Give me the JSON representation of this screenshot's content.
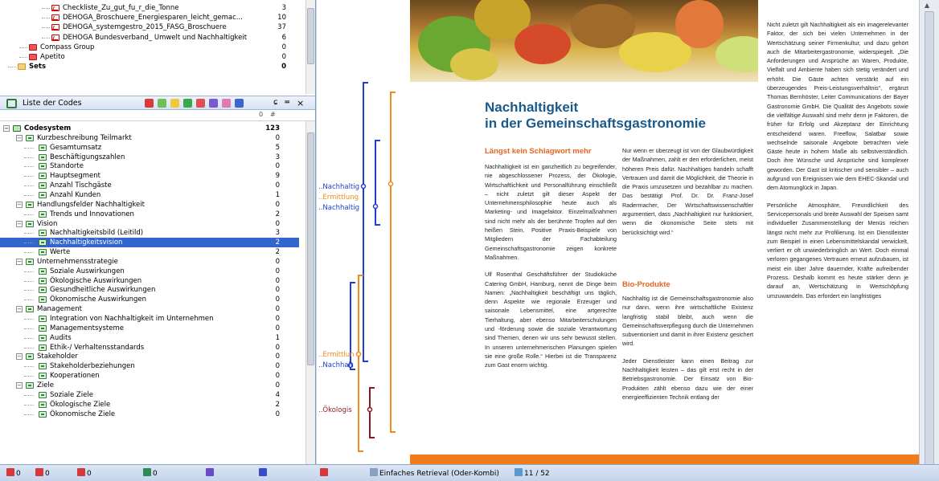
{
  "doc_tree": {
    "rows": [
      {
        "label": "Checkliste_Zu_gut_fu_r_die_Tonne",
        "count": "3",
        "icon": "pdf-icon"
      },
      {
        "label": "DEHOGA_Broschuere_Energiesparen_leicht_gemac...",
        "count": "10",
        "icon": "pdf-icon"
      },
      {
        "label": "DEHOGA_systemgestro_2015_FASG_Broschuere",
        "count": "37",
        "icon": "pdf-icon"
      },
      {
        "label": "DEHOGA Bundesverband_ Umwelt und Nachhaltigkeit",
        "count": "6",
        "icon": "pdf-icon"
      },
      {
        "label": "Compass Group",
        "count": "0",
        "icon": "document-group-icon"
      },
      {
        "label": "Apetito",
        "count": "0",
        "icon": "document-group-icon"
      },
      {
        "label": "Sets",
        "count": "0",
        "icon": "sets-folder-icon"
      }
    ]
  },
  "codes_panel": {
    "title": "Liste der Codes",
    "close": "×",
    "pin": "▫",
    "col_header_count": "#",
    "col_header_zero": "0"
  },
  "code_tree": [
    {
      "label": "Codesystem",
      "count": "123",
      "bold": true
    },
    {
      "label": "Kurzbeschreibung Teilmarkt",
      "count": "0"
    },
    {
      "label": "Gesamtumsatz",
      "count": "5"
    },
    {
      "label": "Beschäftigungszahlen",
      "count": "3"
    },
    {
      "label": "Standorte",
      "count": "0"
    },
    {
      "label": "Hauptsegment",
      "count": "9"
    },
    {
      "label": "Anzahl Tischgäste",
      "count": "0"
    },
    {
      "label": "Anzahl Kunden",
      "count": "1"
    },
    {
      "label": "Handlungsfelder Nachhaltigkeit",
      "count": "0"
    },
    {
      "label": "Trends und Innovationen",
      "count": "2"
    },
    {
      "label": "Vision",
      "count": "0"
    },
    {
      "label": "Nachhaltigkeitsbild (Leitild)",
      "count": "3"
    },
    {
      "label": "Nachhaltigkeitsvision",
      "count": "2",
      "selected": true
    },
    {
      "label": "Werte",
      "count": "2"
    },
    {
      "label": "Unternehmensstrategie",
      "count": "0"
    },
    {
      "label": "Soziale Auswirkungen",
      "count": "0"
    },
    {
      "label": "Ökologische Auswirkungen",
      "count": "0"
    },
    {
      "label": "Gesundheitliche Auswirkungen",
      "count": "0"
    },
    {
      "label": "Ökonomische Auswirkungen",
      "count": "0"
    },
    {
      "label": "Management",
      "count": "0"
    },
    {
      "label": "Integration von Nachhaltigkeit im Unternehmen",
      "count": "0"
    },
    {
      "label": "Managementsysteme",
      "count": "0"
    },
    {
      "label": "Audits",
      "count": "1"
    },
    {
      "label": "Ethik-/ Verhaltensstandards",
      "count": "0"
    },
    {
      "label": "Stakeholder",
      "count": "0"
    },
    {
      "label": "Stakeholderbeziehungen",
      "count": "0"
    },
    {
      "label": "Kooperationen",
      "count": "0"
    },
    {
      "label": "Ziele",
      "count": "0"
    },
    {
      "label": "Soziale Ziele",
      "count": "4"
    },
    {
      "label": "Ökologische Ziele",
      "count": "2"
    },
    {
      "label": "Ökonomische Ziele",
      "count": "0"
    }
  ],
  "coding_stripes": [
    {
      "label": "..Nachhaltig",
      "color": "#1f3fd0"
    },
    {
      "label": "..Ermittlung",
      "color": "#f08a1a"
    },
    {
      "label": "..Nachhaltig",
      "color": "#1f3fd0"
    },
    {
      "label": "..Ermittlun",
      "color": "#f08a1a"
    },
    {
      "label": "..Nachhalt",
      "color": "#1f3fd0"
    },
    {
      "label": "..Ökologis",
      "color": "#8b1a1a"
    }
  ],
  "document": {
    "title_line1": "Nachhaltigkeit",
    "title_line2": "in der Gemeinschaftsgastronomie",
    "sub1": "Längst kein Schlagwort mehr",
    "col1_p1": "Nachhaltigkeit ist ein ganzheitlich zu begreifender, nie abgeschlossener Prozess, der Ökologie, Wirtschaftlichkeit und Personalführung einschließt – nicht zuletzt gilt dieser Aspekt der Unternehmensphilosophie heute auch als Marketing- und Imagefaktor. Einzelmaßnahmen sind nicht mehr als der berühmte Tropfen auf den heißen Stein. Positive Praxis-Beispiele von Mitgliedern der Fachabteilung Gemeinschaftsgastronomie zeigen konkrete Maßnahmen.",
    "col1_p2": "Ulf Rosenthal Geschäftsführer der Studioküche Catering GmbH, Hamburg, nennt die Dinge beim Namen: „Nachhaltigkeit beschäftigt uns täglich, denn Aspekte wie regionale Erzeuger und saisonale Lebensmittel, eine artgerechte Tierhaltung, aber ebenso Mitarbeiterschulungen und -förderung sowie die soziale Verantwortung sind Themen, denen wir uns sehr bewusst stellen. In unseren unternehmerischen Planungen spielen sie eine große Rolle.“ Hierbei ist die Transparenz zum Gast enorm wichtig.",
    "col2_p1": "Nur wenn er überzeugt ist von der Glaubwürdigkeit der Maßnahmen, zahlt er den erforderlichen, meist höheren Preis dafür. Nachhaltiges handeln schafft Vertrauen und damit die Möglichkeit, die Theorie in die Praxis umzusetzen und bezahlbar zu machen. Das bestätigt Prof. Dr. Dr. Franz-Josef Radermacher, Der Wirtschaftswissenschaftler argumentiert, dass „Nachhaltigkeit nur funktioniert, wenn die ökonomische Seite stets mit berücksichtigt wird.“",
    "sub2": "Bio-Produkte",
    "col2_p2": "Nachhaltig ist die Gemeinschaftsgastronomie also nur dann, wenn ihre wirtschaftliche Existenz langfristig stabil bleibt, auch wenn die Gemeinschaftsverpflegung durch die Unternehmen subventioniert und damit in ihrer Existenz gesichert wird.",
    "col2_p3": "Jeder Dienstleister kann einen Beitrag zur Nachhaltigkeit leisten – das gilt erst recht in der Betriebsgastronomie. Der Einsatz von Bio-Produkten zählt ebenso dazu wie der einer energieeffizienten Technik entlang der",
    "col3_p1": "Nicht zuletzt gilt Nachhaltigkeit als ein imagerelevanter Faktor, der sich bei vielen Unternehmen in der Wertschätzung seiner Firmenkultur, und dazu gehört auch die Mitarbeitergastronomie, widerspiegelt. „Die Anforderungen und Ansprüche an Waren, Produkte, Vielfalt und Ambiente haben sich stetig verändert und erhöht. Die Gäste achten verstärkt auf ein überzeugendes Preis-Leistungsverhältnis“, ergänzt Thomas Bernhöster, Leiter Communications der Bayer Gastronomie GmbH. Die Qualität des Angebots sowie die vielfältige Auswahl sind mehr denn je Faktoren, die früher für Erfolg und Akzeptanz der Einrichtung entscheidend waren. Freeflow, Salatbar sowie wechselnde saisonale Angebote betrachten viele Gäste heute in hohem Maße als selbstverständlich. Doch ihre Wünsche und Ansprüche sind komplexer geworden. Der Gast ist kritischer und sensibler – auch aufgrund von Ereignissen wie dem EHEC-Skandal und dem Atomunglück in Japan.",
    "col3_p2": "Persönliche Atmosphäre, Freundlichkeit des Servicepersonals und breite Auswahl der Speisen samt individueller Zusammenstellung der Menüs reichen längst nicht mehr zur Profilierung. Ist ein Dienstleister zum Beispiel in einen Lebensmittelskandal verwickelt, verliert er oft unwiederbringlich an Wert. Doch einmal verloren gegangenes Vertrauen erneut aufzubauen, ist meist ein über Jahre dauernder, Kräfte aufreibender Prozess. Deshalb kommt es heute stärker denn je darauf an, Wertschätzung in Wertschöpfung umzuwandeln. Das erfordert ein langfristiges"
  },
  "status_bar": {
    "items": [
      {
        "icon": "documents-icon",
        "value": "0"
      },
      {
        "icon": "document-groups-icon",
        "value": "0"
      },
      {
        "icon": "code-stripes-icon",
        "value": "0"
      },
      {
        "icon": "coded-segments-icon",
        "value": "0"
      },
      {
        "icon": "variables-icon",
        "value": ""
      },
      {
        "icon": "weight-icon",
        "value": ""
      },
      {
        "icon": "retrieval-arrow-icon",
        "value": ""
      }
    ],
    "retrieval_mode": "Einfaches Retrieval (Oder-Kombi)",
    "page_indicator": "11 / 52"
  },
  "colors": {
    "selected_row": "#3366cc",
    "stripe_blue": "#1f3fd0",
    "stripe_orange": "#f08a1a",
    "stripe_darkred": "#8b1a1a",
    "heading_blue": "#1a5a8a",
    "subheading_orange": "#e8641e"
  }
}
